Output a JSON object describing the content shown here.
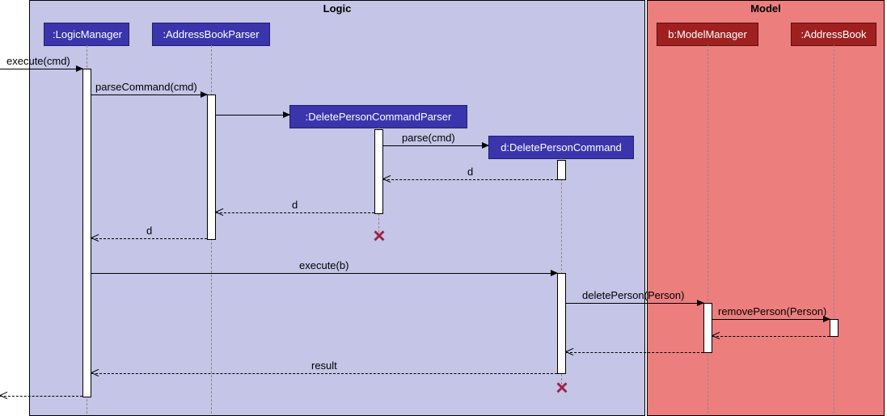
{
  "packages": {
    "logic": {
      "title": "Logic"
    },
    "model": {
      "title": "Model"
    }
  },
  "participants": {
    "logicManager": ":LogicManager",
    "addressBookParser": ":AddressBookParser",
    "deleteParser": ":DeletePersonCommandParser",
    "deleteCommand": "d:DeletePersonCommand",
    "modelManager": "b:ModelManager",
    "addressBook": ":AddressBook"
  },
  "messages": {
    "m1": "execute(cmd)",
    "m2": "parseCommand(cmd)",
    "m3": "parse(cmd)",
    "r3": "d",
    "r2": "d",
    "r1": "d",
    "m4": "execute(b)",
    "m5": "deletePerson(Person)",
    "m6": "removePerson(Person)",
    "r4": "result"
  },
  "chart_data": {
    "type": "sequence-diagram",
    "packages": [
      {
        "name": "Logic",
        "participants": [
          ":LogicManager",
          ":AddressBookParser",
          ":DeletePersonCommandParser",
          "d:DeletePersonCommand"
        ]
      },
      {
        "name": "Model",
        "participants": [
          "b:ModelManager",
          ":AddressBook"
        ]
      }
    ],
    "interactions": [
      {
        "from": "(caller)",
        "to": ":LogicManager",
        "message": "execute(cmd)",
        "kind": "call"
      },
      {
        "from": ":LogicManager",
        "to": ":AddressBookParser",
        "message": "parseCommand(cmd)",
        "kind": "call"
      },
      {
        "from": ":AddressBookParser",
        "to": ":DeletePersonCommandParser",
        "message": "",
        "kind": "create"
      },
      {
        "from": ":DeletePersonCommandParser",
        "to": "d:DeletePersonCommand",
        "message": "parse(cmd)",
        "kind": "create"
      },
      {
        "from": "d:DeletePersonCommand",
        "to": ":DeletePersonCommandParser",
        "message": "d",
        "kind": "return"
      },
      {
        "from": ":DeletePersonCommandParser",
        "to": ":AddressBookParser",
        "message": "d",
        "kind": "return"
      },
      {
        "note": ":DeletePersonCommandParser destroyed",
        "kind": "destroy"
      },
      {
        "from": ":AddressBookParser",
        "to": ":LogicManager",
        "message": "d",
        "kind": "return"
      },
      {
        "from": ":LogicManager",
        "to": "d:DeletePersonCommand",
        "message": "execute(b)",
        "kind": "call"
      },
      {
        "from": "d:DeletePersonCommand",
        "to": "b:ModelManager",
        "message": "deletePerson(Person)",
        "kind": "call"
      },
      {
        "from": "b:ModelManager",
        "to": ":AddressBook",
        "message": "removePerson(Person)",
        "kind": "call"
      },
      {
        "from": ":AddressBook",
        "to": "b:ModelManager",
        "message": "",
        "kind": "return"
      },
      {
        "from": "b:ModelManager",
        "to": "d:DeletePersonCommand",
        "message": "",
        "kind": "return"
      },
      {
        "from": "d:DeletePersonCommand",
        "to": ":LogicManager",
        "message": "result",
        "kind": "return"
      },
      {
        "note": "d:DeletePersonCommand destroyed",
        "kind": "destroy"
      },
      {
        "from": ":LogicManager",
        "to": "(caller)",
        "message": "",
        "kind": "return"
      }
    ]
  }
}
